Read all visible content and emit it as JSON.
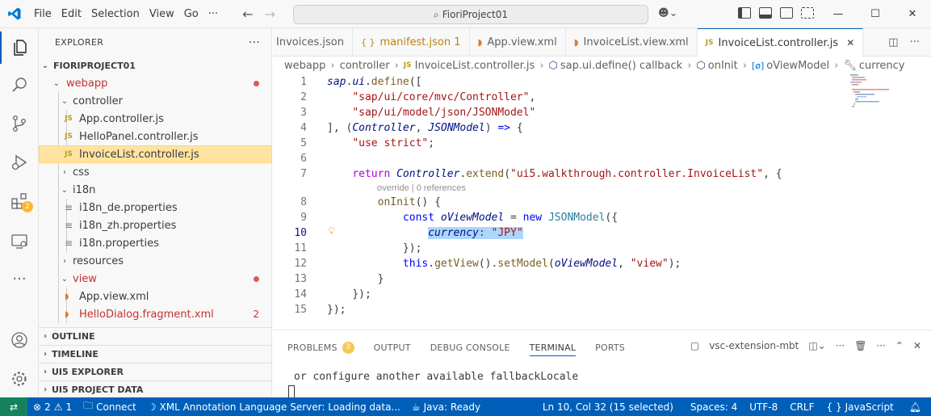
{
  "titlebar": {
    "menu": [
      "File",
      "Edit",
      "Selection",
      "View",
      "Go"
    ],
    "command_center": "FioriProject01",
    "more": "···"
  },
  "explorer": {
    "title": "EXPLORER",
    "project": "FIORIPROJECT01",
    "items": [
      {
        "label": "webapp",
        "kind": "folder",
        "open": true,
        "color": "#c53030",
        "marker": "dot"
      },
      {
        "label": "controller",
        "kind": "folder",
        "open": true
      },
      {
        "label": "App.controller.js",
        "kind": "js"
      },
      {
        "label": "HelloPanel.controller.js",
        "kind": "js"
      },
      {
        "label": "InvoiceList.controller.js",
        "kind": "js",
        "selected": true
      },
      {
        "label": "css",
        "kind": "folder",
        "open": false
      },
      {
        "label": "i18n",
        "kind": "folder",
        "open": true
      },
      {
        "label": "i18n_de.properties",
        "kind": "prop"
      },
      {
        "label": "i18n_zh.properties",
        "kind": "prop"
      },
      {
        "label": "i18n.properties",
        "kind": "prop"
      },
      {
        "label": "resources",
        "kind": "folder",
        "open": false
      },
      {
        "label": "view",
        "kind": "folder",
        "open": true,
        "color": "#c53030",
        "marker": "dot"
      },
      {
        "label": "App.view.xml",
        "kind": "xml"
      },
      {
        "label": "HelloDialog.fragment.xml",
        "kind": "xml",
        "color": "#c53030",
        "count": "2"
      }
    ],
    "sections": [
      "OUTLINE",
      "TIMELINE",
      "UI5 EXPLORER",
      "UI5 PROJECT DATA"
    ]
  },
  "tabs": [
    {
      "label": "Invoices.json",
      "icon": "",
      "active": false
    },
    {
      "label": "manifest.json 1",
      "icon": "{ }",
      "color": "#b8860b",
      "active": false
    },
    {
      "label": "App.view.xml",
      "icon": "rss-icon",
      "active": false
    },
    {
      "label": "InvoiceList.view.xml",
      "icon": "rss-icon",
      "active": false
    },
    {
      "label": "InvoiceList.controller.js",
      "icon": "JS",
      "active": true
    }
  ],
  "breadcrumbs": [
    "webapp",
    "controller",
    "InvoiceList.controller.js",
    "sap.ui.define() callback",
    "onInit",
    "oViewModel",
    "currency"
  ],
  "editor": {
    "lines": [
      "1",
      "2",
      "3",
      "4",
      "5",
      "6",
      "7",
      "8",
      "9",
      "10",
      "11",
      "12",
      "13",
      "14",
      "15"
    ],
    "codelens": "override | 0 references"
  },
  "panel": {
    "tabs": [
      "PROBLEMS",
      "OUTPUT",
      "DEBUG CONSOLE",
      "TERMINAL",
      "PORTS"
    ],
    "problems_count": "3",
    "terminal_name": "vsc-extension-mbt",
    "terminal_text": "or configure another available fallbackLocale"
  },
  "activity_badge": "2",
  "status": {
    "errors": "2",
    "warnings": "1",
    "connect": "Connect",
    "xml_server": "XML Annotation Language Server: Loading data...",
    "java": "Java: Ready",
    "position": "Ln 10, Col 32 (15 selected)",
    "spaces": "Spaces: 4",
    "encoding": "UTF-8",
    "eol": "CRLF",
    "language": "JavaScript"
  },
  "colors": {
    "accent": "#005fb8",
    "selection": "#ffe3a0",
    "error": "#c53030",
    "remote": "#16825d"
  }
}
